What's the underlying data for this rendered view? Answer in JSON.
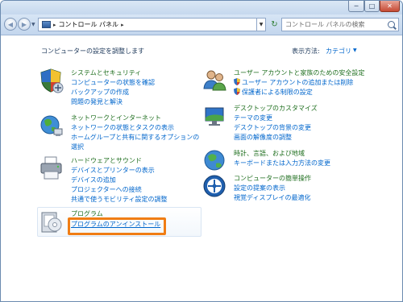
{
  "window": {
    "controls": {
      "minimize": "─",
      "maximize": "□",
      "close": "✕"
    }
  },
  "nav": {
    "back_icon": "back-arrow-icon",
    "forward_icon": "forward-arrow-icon",
    "back_glyph": "◀",
    "forward_glyph": "▶",
    "dropdown_glyph": "▼",
    "breadcrumb": [
      "コントロール パネル"
    ],
    "separator": "▸",
    "refresh_glyph": "↻",
    "search_placeholder": "コントロール パネルの検索"
  },
  "main": {
    "heading": "コンピューターの設定を調整します",
    "view_by_label": "表示方法:",
    "view_by_value": "カテゴリ",
    "view_by_arrow": "▼"
  },
  "categories": [
    {
      "title": "システムとセキュリティ",
      "links": [
        "コンピューターの状態を確認",
        "バックアップの作成",
        "問題の発見と解決"
      ]
    },
    {
      "title": "ネットワークとインターネット",
      "links": [
        "ネットワークの状態とタスクの表示",
        "ホームグループと共有に関するオプションの",
        "選択"
      ]
    },
    {
      "title": "ハードウェアとサウンド",
      "links": [
        "デバイスとプリンターの表示",
        "デバイスの追加",
        "プロジェクターへの接続",
        "共通で使うモビリティ設定の調整"
      ]
    },
    {
      "title": "プログラム",
      "links": [
        "プログラムのアンインストール"
      ]
    },
    {
      "title": "ユーザー アカウントと家族のための安全設定",
      "links": [
        "ユーザー アカウントの追加または削除",
        "保護者による制限の設定"
      ]
    },
    {
      "title": "デスクトップのカスタマイズ",
      "links": [
        "テーマの変更",
        "デスクトップの背景の変更",
        "画面の解像度の調整"
      ]
    },
    {
      "title": "時計、言語、および地域",
      "links": [
        "キーボードまたは入力方法の変更"
      ]
    },
    {
      "title": "コンピューターの簡単操作",
      "links": [
        "設定の提案の表示",
        "視覚ディスプレイの最適化"
      ]
    }
  ],
  "colors": {
    "category_title": "#1e6e1e",
    "link": "#0066cc",
    "highlight": "#f07d14"
  }
}
